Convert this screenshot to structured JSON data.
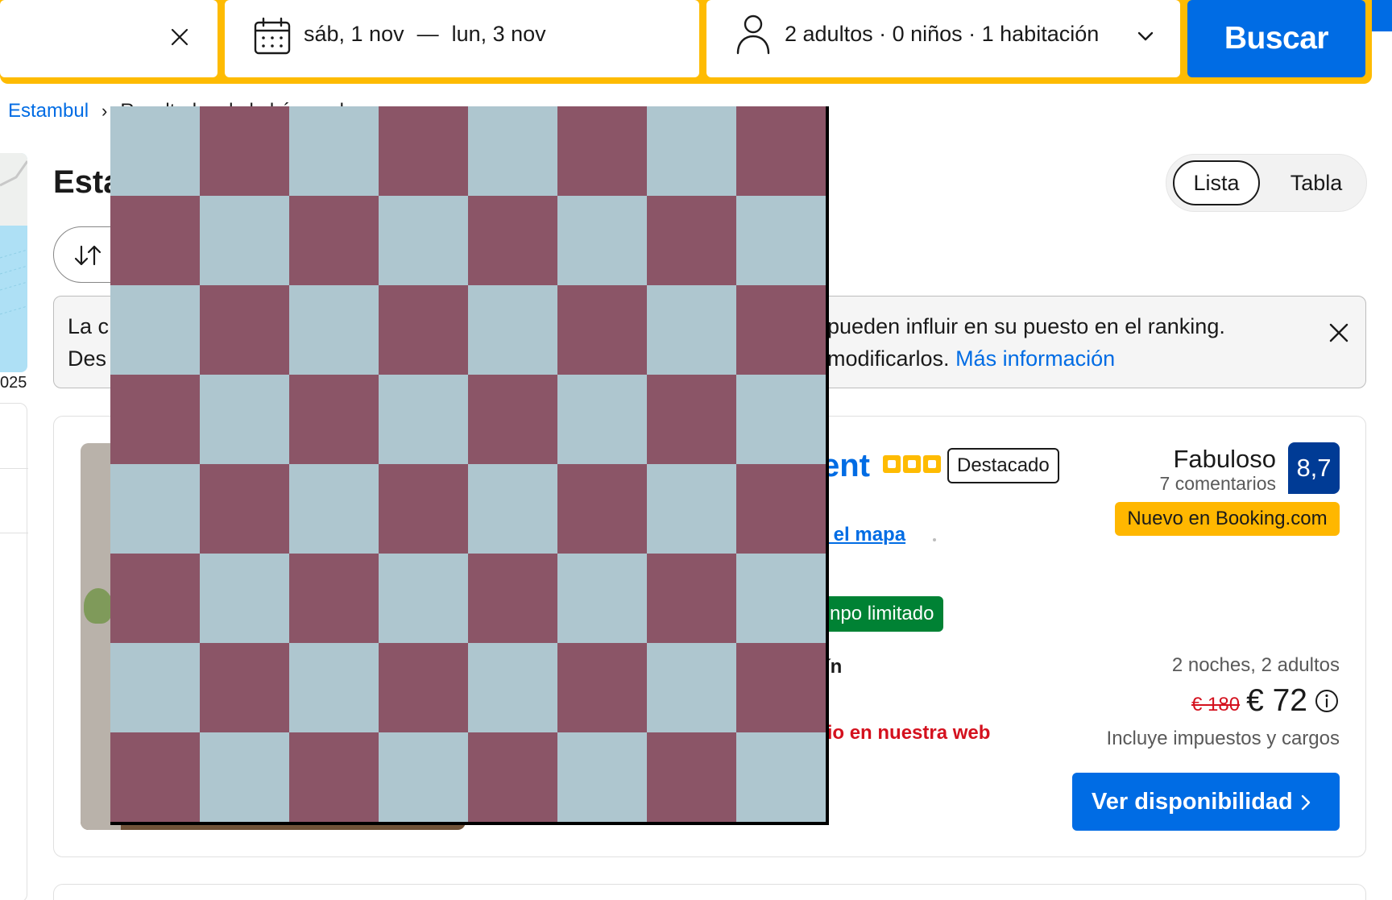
{
  "search": {
    "dates_start": "sáb, 1 nov",
    "dates_separator": "—",
    "dates_end": "lun, 3 nov",
    "occupancy": "2 adultos · 0 niños · 1 habitación",
    "search_button": "Buscar"
  },
  "breadcrumb": {
    "city": "Estambul",
    "separator": "›",
    "current": "Resultados de la búsqueda"
  },
  "map": {
    "year_fragment": "025"
  },
  "header": {
    "title_fragment": "Esta",
    "view_list": "Lista",
    "view_table": "Tabla"
  },
  "banner": {
    "line1_start": "La c",
    "line2_start": "Des",
    "line1_end": "pueden influir en su puesto en el ranking.",
    "line2_end": "modificarlos.",
    "link": "Más información"
  },
  "property": {
    "name_fragment": "ent",
    "stars": 3,
    "featured_badge": "Destacado",
    "map_link": "en el mapa",
    "deal_badge": "npo limitado",
    "room_type": "rdín",
    "web_price": "ecio en nuestra web",
    "rating_word": "Fabuloso",
    "review_count": "7 comentarios",
    "score": "8,7",
    "new_badge": "Nuevo en Booking.com",
    "stay_info": "2 noches, 2 adultos",
    "price_old": "€ 180",
    "price_now": "€ 72",
    "taxes": "Incluye impuestos y cargos",
    "availability_button": "Ver disponibilidad"
  },
  "overlay": {
    "rows": 8,
    "cols": 8,
    "color_a": "#aec6cf",
    "color_b": "#8b5567"
  },
  "colors": {
    "brand_blue": "#006ce4",
    "accent_yellow": "#febb02",
    "score_blue": "#003b95",
    "deal_green": "#008234",
    "price_red": "#d4111e"
  },
  "icons": {
    "clear": "close-icon",
    "dates": "calendar-icon",
    "occupancy": "person-icon",
    "dropdown": "chevron-down-icon",
    "sort": "sort-icon",
    "banner_close": "close-icon",
    "price_info": "info-icon",
    "availability_arrow": "chevron-right-icon"
  }
}
